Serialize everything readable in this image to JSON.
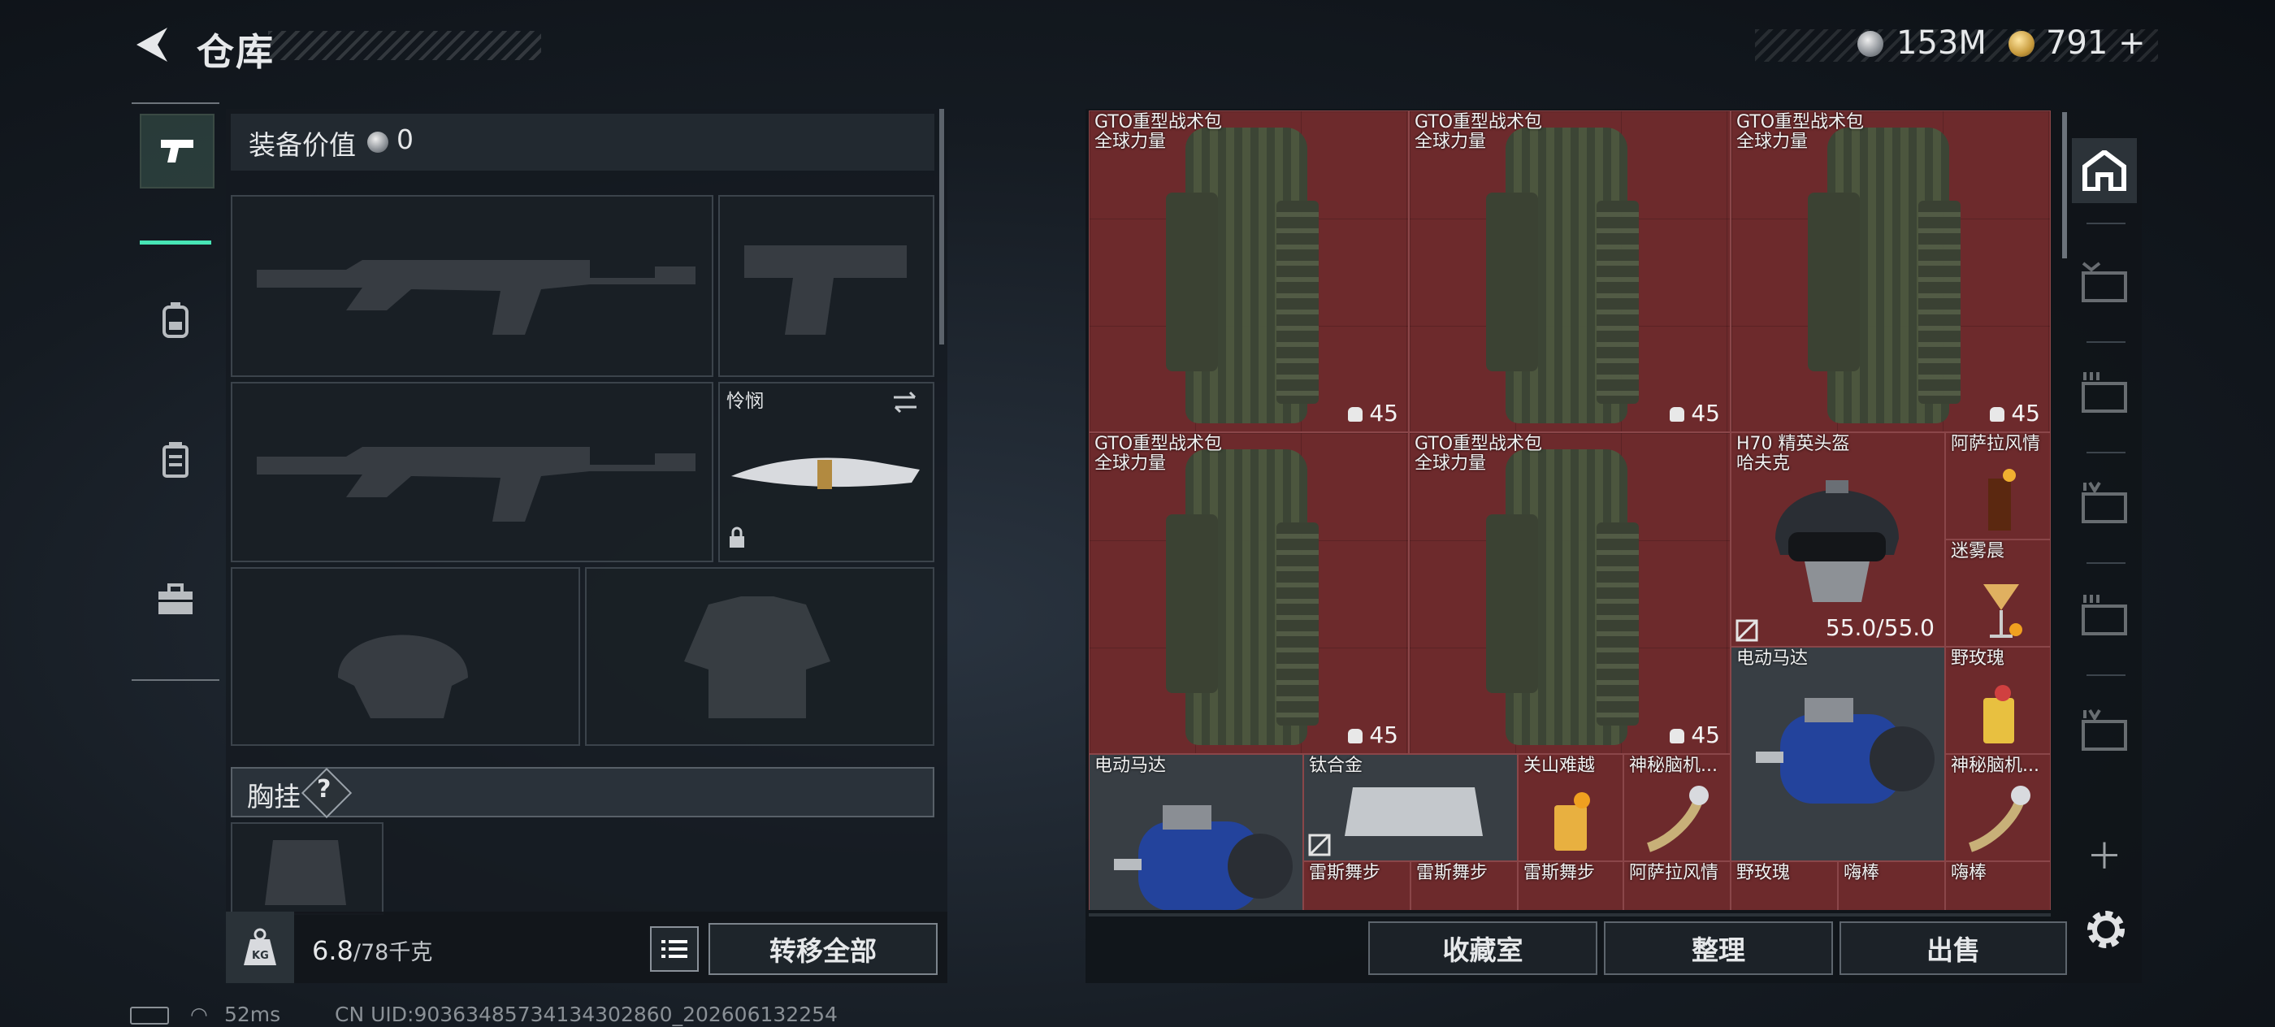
{
  "header": {
    "title": "仓库",
    "money": "153M",
    "tokens": "791",
    "tokens_plus": "+"
  },
  "loadout": {
    "equip_value_label": "装备价值",
    "equip_value": "0",
    "melee_name": "怜悯",
    "chest_label": "胸挂",
    "chest_help": "?",
    "weight_current": "6.8",
    "weight_max": "/78千克",
    "transfer_all": "转移全部"
  },
  "stash": {
    "items": [
      {
        "name": "GTO重型战术包",
        "sub": "全球力量",
        "count": "45"
      },
      {
        "name": "GTO重型战术包",
        "sub": "全球力量",
        "count": "45"
      },
      {
        "name": "GTO重型战术包",
        "sub": "全球力量",
        "count": "45"
      },
      {
        "name": "GTO重型战术包",
        "sub": "全球力量",
        "count": "45"
      },
      {
        "name": "GTO重型战术包",
        "sub": "全球力量",
        "count": "45"
      },
      {
        "name": "H70 精英头盔",
        "sub": "哈夫克",
        "durability": "55.0/55.0"
      },
      {
        "name": "阿萨拉风情"
      },
      {
        "name": "迷雾晨"
      },
      {
        "name": "电动马达"
      },
      {
        "name": "野玫瑰"
      },
      {
        "name": "电动马达"
      },
      {
        "name": "钛合金"
      },
      {
        "name": "关山难越"
      },
      {
        "name": "神秘脑机..."
      },
      {
        "name": "神秘脑机..."
      },
      {
        "name": "雷斯舞步"
      },
      {
        "name": "雷斯舞步"
      },
      {
        "name": "雷斯舞步"
      },
      {
        "name": "阿萨拉风情"
      },
      {
        "name": "野玫瑰"
      },
      {
        "name": "嗨棒"
      },
      {
        "name": "嗨棒"
      }
    ],
    "buttons": {
      "collection": "收藏室",
      "organize": "整理",
      "sell": "出售"
    }
  },
  "status": {
    "ping": "52ms",
    "uid": "CN UID:90363485734134302860_202606132254"
  },
  "colors": {
    "accent": "#47e5b5",
    "cell_red": "#6d2a2c",
    "cell_gray": "#383e44"
  },
  "icons": [
    "back-icon",
    "silver-coin-icon",
    "gold-coin-icon",
    "pistol-icon",
    "backpack-icon",
    "chest-rig-icon",
    "toolbox-icon",
    "home-icon",
    "gear-icon",
    "kg-weight-icon",
    "list-icon",
    "lock-icon",
    "swap-icon",
    "broken-icon"
  ]
}
